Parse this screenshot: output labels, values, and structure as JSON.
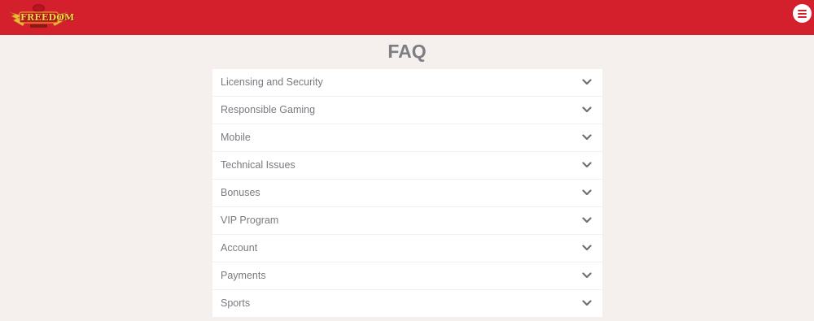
{
  "header": {
    "logo_text": "FREEDOM",
    "logo_subtext": "CASINO",
    "menu_icon": "hamburger-menu-icon",
    "brand_color": "#d4202d"
  },
  "main": {
    "title": "FAQ",
    "faq_items": [
      {
        "label": "Licensing and Security",
        "icon": "chevron-down-icon"
      },
      {
        "label": "Responsible Gaming",
        "icon": "chevron-down-icon"
      },
      {
        "label": "Mobile",
        "icon": "chevron-down-icon"
      },
      {
        "label": "Technical Issues",
        "icon": "chevron-down-icon"
      },
      {
        "label": "Bonuses",
        "icon": "chevron-down-icon"
      },
      {
        "label": "VIP Program",
        "icon": "chevron-down-icon"
      },
      {
        "label": "Account",
        "icon": "chevron-down-icon"
      },
      {
        "label": "Payments",
        "icon": "chevron-down-icon"
      },
      {
        "label": "Sports",
        "icon": "chevron-down-icon"
      }
    ]
  },
  "colors": {
    "background": "#f5f0ee",
    "title": "#7d7d85",
    "item_text": "#7a7a80",
    "chevron": "#6e6e74"
  }
}
